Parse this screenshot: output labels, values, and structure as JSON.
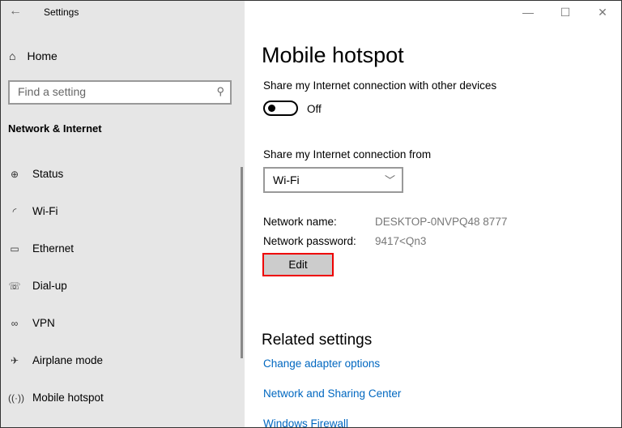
{
  "window": {
    "title": "Settings",
    "controls": [
      "—",
      "☐",
      "✕"
    ]
  },
  "sidebar": {
    "home": "Home",
    "search_placeholder": "Find a setting",
    "section": "Network & Internet",
    "items": [
      {
        "label": "Status",
        "icon": "globe-monitor-icon"
      },
      {
        "label": "Wi-Fi",
        "icon": "wifi-icon"
      },
      {
        "label": "Ethernet",
        "icon": "ethernet-icon"
      },
      {
        "label": "Dial-up",
        "icon": "phone-icon"
      },
      {
        "label": "VPN",
        "icon": "vpn-icon"
      },
      {
        "label": "Airplane mode",
        "icon": "airplane-icon"
      },
      {
        "label": "Mobile hotspot",
        "icon": "hotspot-icon"
      }
    ]
  },
  "main": {
    "title": "Mobile hotspot",
    "share_label": "Share my Internet connection with other devices",
    "toggle_state": "Off",
    "from_label": "Share my Internet connection from",
    "from_value": "Wi-Fi",
    "network_name_label": "Network name:",
    "network_name": "DESKTOP-0NVPQ48 8777",
    "password_label": "Network password:",
    "password": "9417<Qn3",
    "edit_label": "Edit",
    "related_title": "Related settings",
    "links": [
      "Change adapter options",
      "Network and Sharing Center",
      "Windows Firewall"
    ],
    "highlight_color": "#e00000"
  }
}
